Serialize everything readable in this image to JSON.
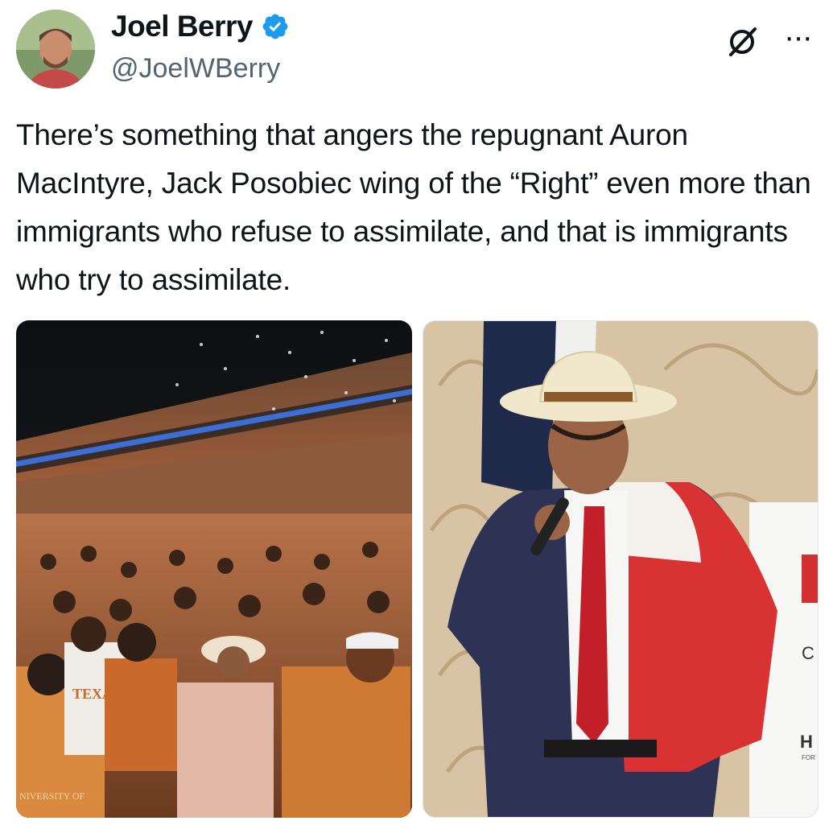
{
  "author": {
    "display_name": "Joel Berry",
    "handle": "@JoelWBerry",
    "verified": true,
    "verified_color": "#1d9bf0"
  },
  "icons": {
    "verified": "verified-badge-icon",
    "grok": "grok-icon",
    "more": "more-options-icon",
    "more_glyph": "···"
  },
  "tweet": {
    "text": "There’s something that angers the repugnant Auron MacIntyre, Jack Posobiec wing of the “Right” even more than immigrants who refuse to assimilate, and that is immigrants who try to assimilate."
  },
  "media": {
    "left": {
      "shirt_text": "TEXAS",
      "banner_text": "NIVERSITY OF"
    },
    "right": {
      "sign_letters": [
        "C",
        "H",
        "FOR"
      ]
    }
  }
}
